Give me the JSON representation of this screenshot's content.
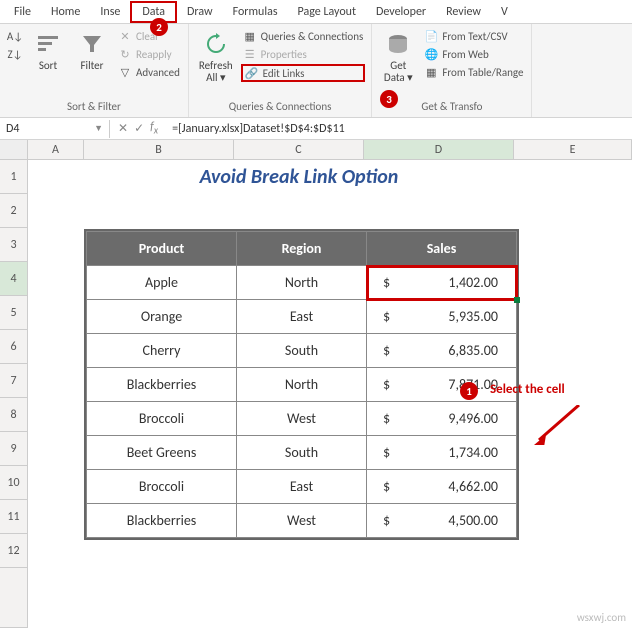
{
  "tabs": {
    "file": "File",
    "home": "Home",
    "insert": "Inse",
    "data": "Data",
    "draw": "Draw",
    "formulas": "Formulas",
    "page": "Page Layout",
    "developer": "Developer",
    "review": "Review",
    "v": "V"
  },
  "ribbon": {
    "sort_filter": {
      "label": "Sort & Filter",
      "sort": "Sort",
      "filter": "Filter",
      "clear": "Clear",
      "reapply": "Reapply",
      "advanced": "Advanced",
      "az": "A→Z",
      "za": "Z→A"
    },
    "queries": {
      "label": "Queries & Connections",
      "refresh": "Refresh\nAll",
      "qc": "Queries & Connections",
      "props": "Properties",
      "edit": "Edit Links"
    },
    "getdata": {
      "label": "Get & Transfo",
      "get": "Get\nData",
      "textcsv": "From Text/CSV",
      "web": "From Web",
      "table": "From Table/Range"
    }
  },
  "callouts": {
    "c1": "1",
    "c2": "2",
    "c3": "3",
    "sel": "Select the cell"
  },
  "namebox": "D4",
  "formula": "=[January.xlsx]Dataset!$D$4:$D$11",
  "cols": {
    "A": "A",
    "B": "B",
    "C": "C",
    "D": "D",
    "E": "E"
  },
  "title": "Avoid Break Link Option",
  "headers": {
    "product": "Product",
    "region": "Region",
    "sales": "Sales"
  },
  "chart_data": {
    "type": "table",
    "columns": [
      "Product",
      "Region",
      "Sales"
    ],
    "rows": [
      {
        "product": "Apple",
        "region": "North",
        "sales": "1,402.00"
      },
      {
        "product": "Orange",
        "region": "East",
        "sales": "5,935.00"
      },
      {
        "product": "Cherry",
        "region": "South",
        "sales": "6,835.00"
      },
      {
        "product": "Blackberries",
        "region": "North",
        "sales": "7,871.00"
      },
      {
        "product": "Broccoli",
        "region": "West",
        "sales": "9,496.00"
      },
      {
        "product": "Beet Greens",
        "region": "South",
        "sales": "1,734.00"
      },
      {
        "product": "Broccoli",
        "region": "East",
        "sales": "4,662.00"
      },
      {
        "product": "Blackberries",
        "region": "West",
        "sales": "4,500.00"
      }
    ],
    "currency": "$"
  },
  "watermark": "wsxwj.com"
}
